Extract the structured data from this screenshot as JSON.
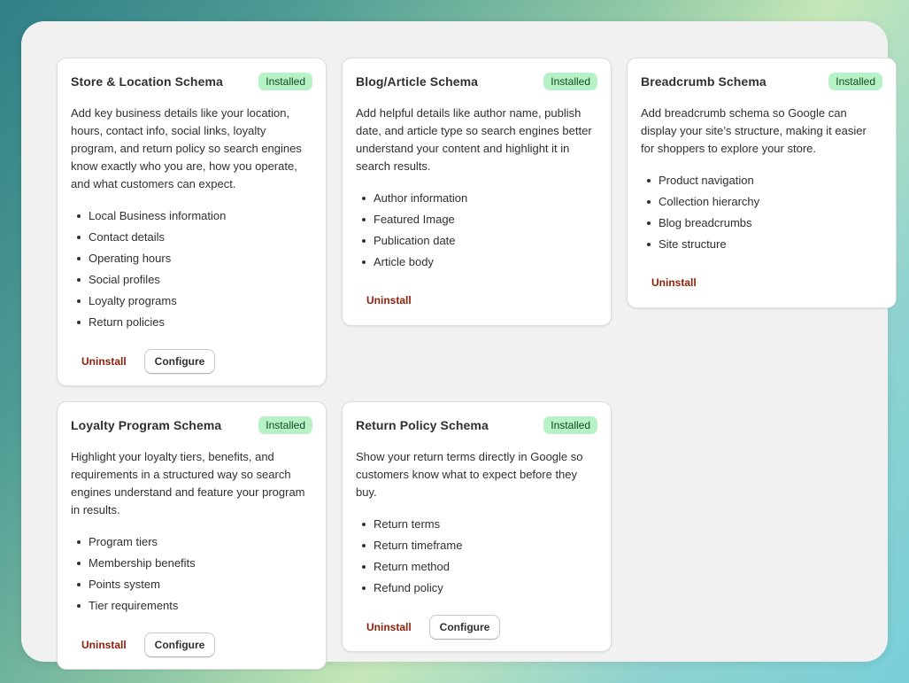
{
  "colors": {
    "badge_bg": "#b6f2c6",
    "badge_text": "#0f4b23",
    "uninstall_text": "#8e1f0b",
    "panel_bg": "#f1f1f1"
  },
  "cards": [
    {
      "title": "Store & Location Schema",
      "badge": "Installed",
      "description": "Add key business details like your location, hours, contact info, social links, loyalty program, and return policy so search engines know exactly who you are, how you operate, and what customers can expect.",
      "features": [
        "Local Business information",
        "Contact details",
        "Operating hours",
        "Social profiles",
        "Loyalty programs",
        "Return policies"
      ],
      "uninstall_label": "Uninstall",
      "configure_label": "Configure"
    },
    {
      "title": "Blog/Article Schema",
      "badge": "Installed",
      "description": "Add helpful details like author name, publish date, and article type so search engines better understand your content and highlight it in search results.",
      "features": [
        "Author information",
        "Featured Image",
        "Publication date",
        "Article body"
      ],
      "uninstall_label": "Uninstall"
    },
    {
      "title": "Breadcrumb Schema",
      "badge": "Installed",
      "description": "Add breadcrumb schema so Google can display your site’s structure, making it easier for shoppers to explore your store.",
      "features": [
        "Product navigation",
        "Collection hierarchy",
        "Blog breadcrumbs",
        "Site structure"
      ],
      "uninstall_label": "Uninstall"
    },
    {
      "title": "Loyalty Program Schema",
      "badge": "Installed",
      "description": "Highlight your loyalty tiers, benefits, and requirements in a structured way so search engines understand and feature your program in results.",
      "features": [
        "Program tiers",
        "Membership benefits",
        "Points system",
        "Tier requirements"
      ],
      "uninstall_label": "Uninstall",
      "configure_label": "Configure"
    },
    {
      "title": "Return Policy Schema",
      "badge": "Installed",
      "description": "Show your return terms directly in Google so customers know what to expect before they buy.",
      "features": [
        "Return terms",
        "Return timeframe",
        "Return method",
        "Refund policy"
      ],
      "uninstall_label": "Uninstall",
      "configure_label": "Configure"
    }
  ]
}
